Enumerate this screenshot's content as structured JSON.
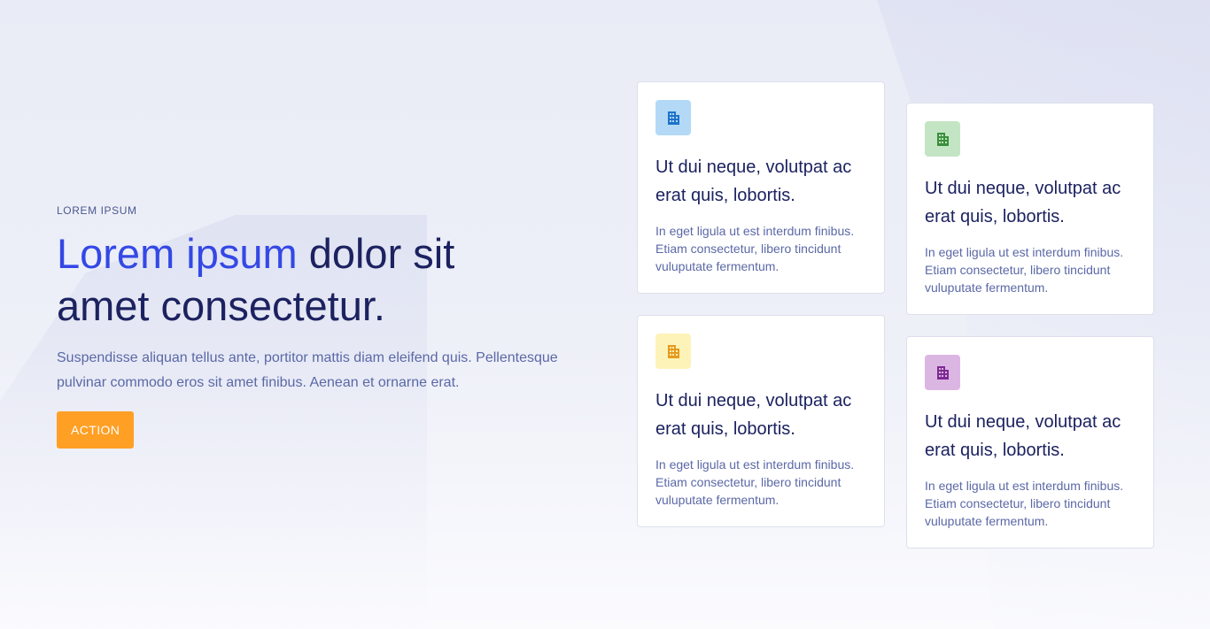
{
  "hero": {
    "eyebrow": "LOREM IPSUM",
    "headline_accent": "Lorem ipsum",
    "headline_rest_1": " dolor sit",
    "headline_rest_2": "amet consectetur.",
    "lead": "Suspendisse aliquan tellus ante, portitor mattis diam eleifend quis. Pellentesque pulvinar commodo eros sit amet finibus. Aenean et ornarne erat.",
    "action_label": "ACTION"
  },
  "colors": {
    "accent": "#3448e6",
    "heading": "#1c2260",
    "button": "#ff9f24"
  },
  "cards": [
    {
      "icon": "building-icon",
      "icon_bg": "#b3d9f7",
      "icon_color": "#1d72c9",
      "title": "Ut dui neque, volutpat ac erat quis, lobortis.",
      "text": "In eget ligula ut est interdum finibus. Etiam consectetur, libero tincidunt vuluputate fermentum."
    },
    {
      "icon": "building-icon",
      "icon_bg": "#c3e5c4",
      "icon_color": "#3a8f3c",
      "title": "Ut dui neque, volutpat ac erat quis, lobortis.",
      "text": "In eget ligula ut est interdum finibus. Etiam consectetur, libero tincidunt vuluputate fermentum."
    },
    {
      "icon": "building-icon",
      "icon_bg": "#fdf3b8",
      "icon_color": "#e79a1e",
      "title": "Ut dui neque, volutpat ac erat quis, lobortis.",
      "text": "In eget ligula ut est interdum finibus. Etiam consectetur, libero tincidunt vuluputate fermentum."
    },
    {
      "icon": "building-icon",
      "icon_bg": "#dcb6e3",
      "icon_color": "#7c2a93",
      "title": "Ut dui neque, volutpat ac erat quis, lobortis.",
      "text": "In eget ligula ut est interdum finibus. Etiam consectetur, libero tincidunt vuluputate fermentum."
    }
  ]
}
